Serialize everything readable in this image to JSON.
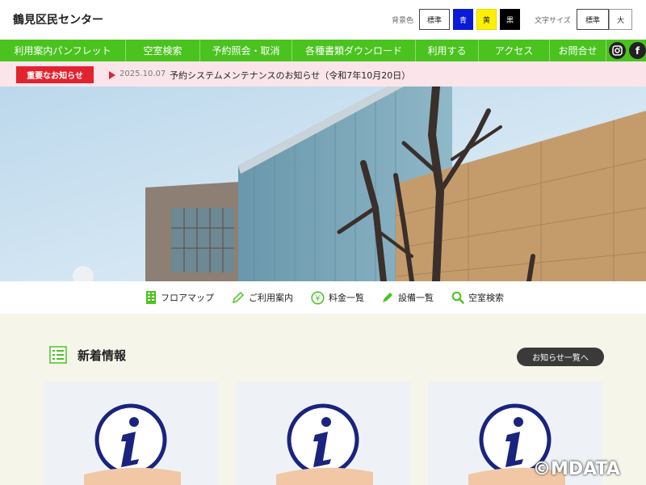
{
  "header": {
    "site_title": "鶴見区民センター",
    "bg_color_label": "背景色",
    "bg_colors": [
      {
        "label": "標準"
      },
      {
        "label": "青",
        "color": "#0a1ad6"
      },
      {
        "label": "黄",
        "color": "#ffef00"
      },
      {
        "label": "黒",
        "color": "#000000"
      }
    ],
    "font_size_label": "文字サイズ",
    "font_sizes": [
      {
        "label": "標準"
      },
      {
        "label": "大"
      }
    ]
  },
  "nav": {
    "items": [
      {
        "label": "利用案内パンフレット"
      },
      {
        "label": "空室検索"
      },
      {
        "label": "予約照会・取消"
      },
      {
        "label": "各種書類ダウンロード"
      },
      {
        "label": "利用する"
      },
      {
        "label": "アクセス"
      },
      {
        "label": "お問合せ"
      }
    ],
    "social": {
      "instagram": "instagram-icon",
      "facebook": "facebook-icon",
      "facebook_glyph": "f"
    },
    "color": "#4ac31e"
  },
  "notice": {
    "badge": "重要なお知らせ",
    "date": "2025.10.07",
    "text": "予約システムメンテナンスのお知らせ（令和7年10月20日）"
  },
  "quick_links": [
    {
      "label": "フロアマップ",
      "icon": "building-icon"
    },
    {
      "label": "ご利用案内",
      "icon": "pencil-icon"
    },
    {
      "label": "料金一覧",
      "icon": "yen-icon",
      "glyph": "¥"
    },
    {
      "label": "設備一覧",
      "icon": "pen-icon"
    },
    {
      "label": "空室検索",
      "icon": "search-icon"
    }
  ],
  "news": {
    "title": "新着情報",
    "more_label": "お知らせ一覧へ"
  },
  "watermark": "©MDATA"
}
